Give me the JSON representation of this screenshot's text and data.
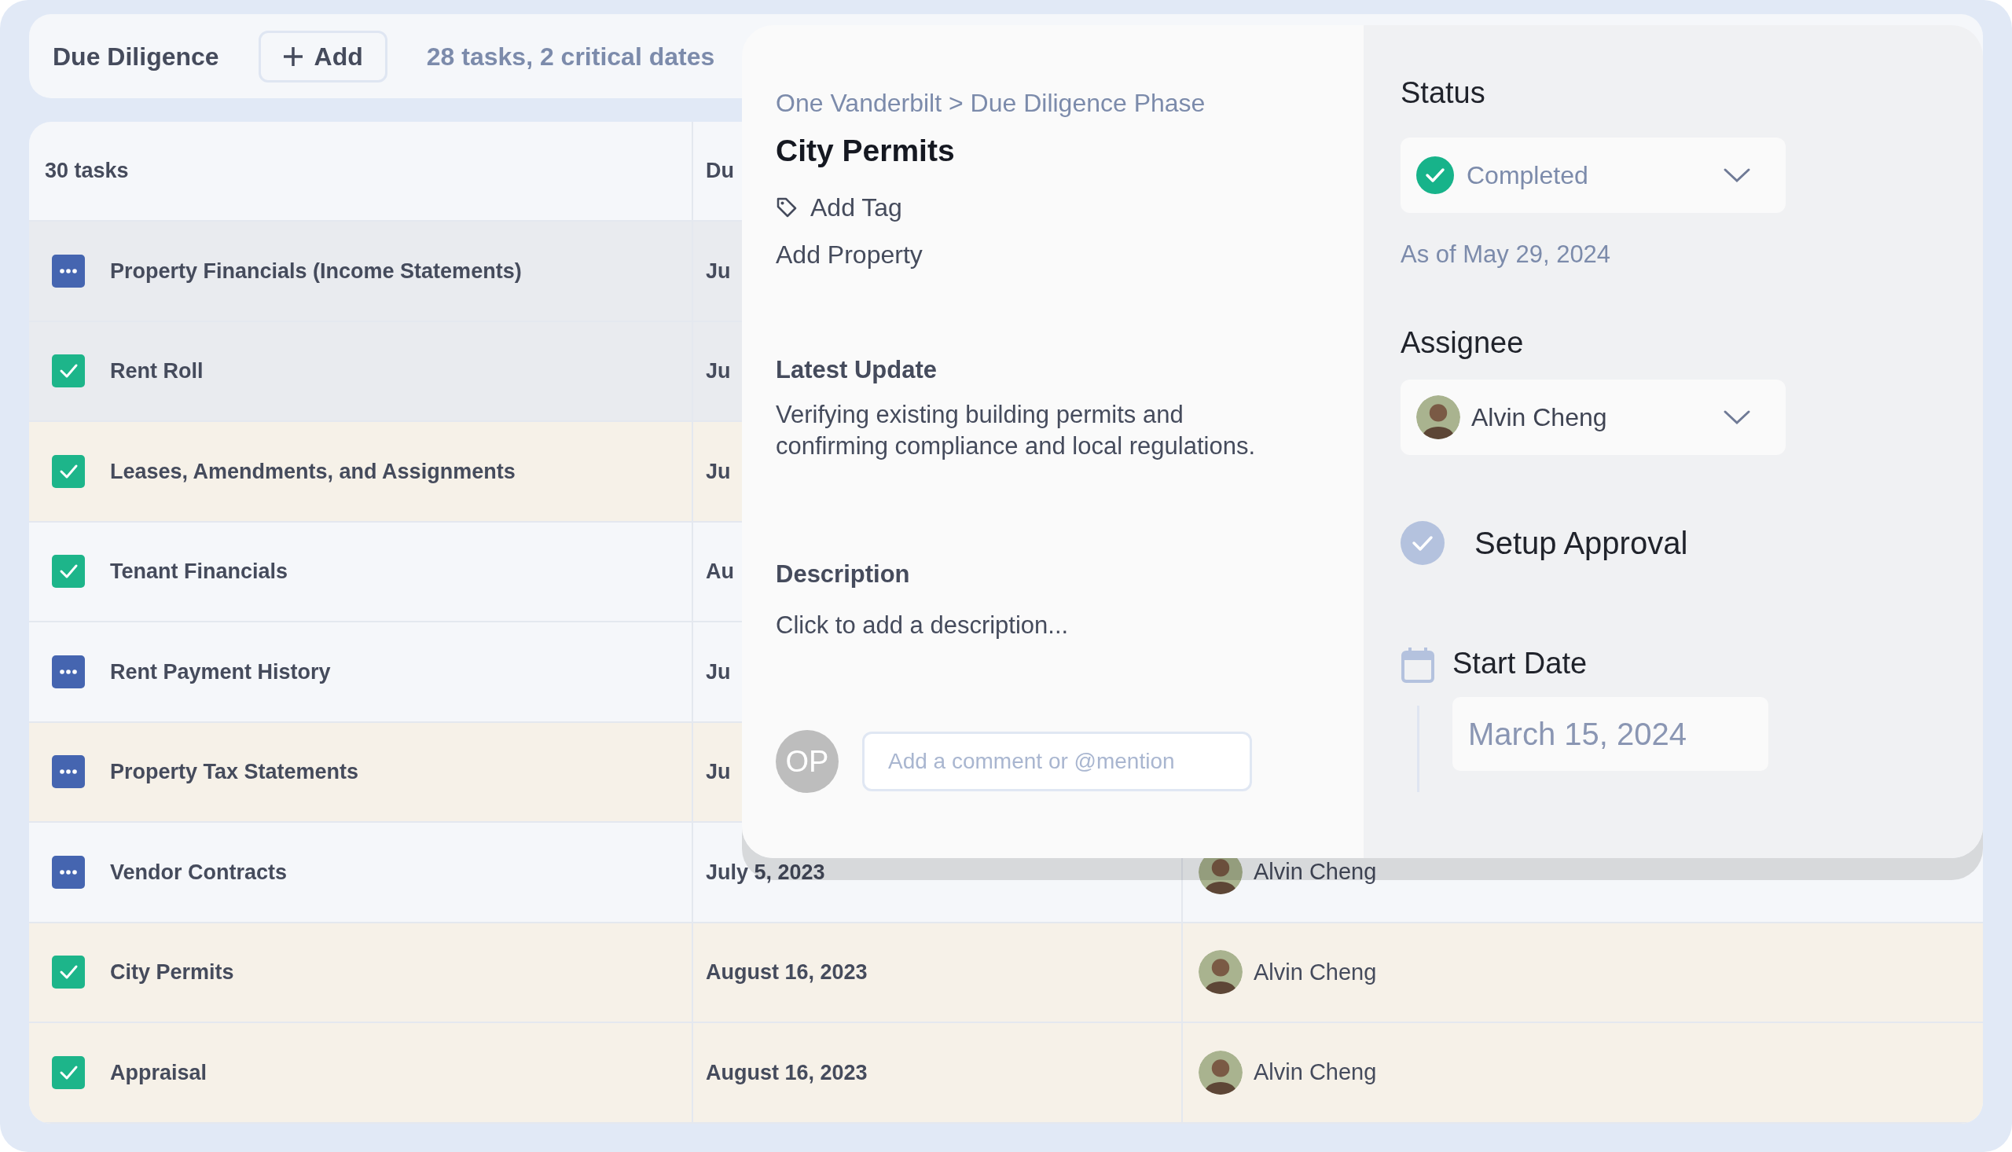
{
  "header": {
    "title": "Due Diligence",
    "add_button": "Add",
    "summary": "28 tasks, 2 critical dates"
  },
  "table": {
    "columns": [
      "30 tasks",
      "Du"
    ],
    "rows": [
      {
        "name": "Property Financials (Income Statements)",
        "done": false,
        "date": "Ju",
        "selected": true,
        "critical": false
      },
      {
        "name": "Rent Roll",
        "done": true,
        "date": "Ju",
        "selected": true,
        "critical": false
      },
      {
        "name": "Leases, Amendments, and Assignments",
        "done": true,
        "date": "Ju",
        "selected": false,
        "critical": true
      },
      {
        "name": "Tenant Financials",
        "done": true,
        "date": "Au",
        "selected": false,
        "critical": false
      },
      {
        "name": "Rent Payment History",
        "done": false,
        "date": "Ju",
        "selected": false,
        "critical": false
      },
      {
        "name": "Property Tax Statements",
        "done": false,
        "date": "Ju",
        "selected": false,
        "critical": true
      },
      {
        "name": "Vendor Contracts",
        "done": false,
        "date": "July 5, 2023",
        "assignee": "Alvin Cheng",
        "selected": false,
        "critical": false
      },
      {
        "name": "City Permits",
        "done": true,
        "date": "August 16, 2023",
        "assignee": "Alvin Cheng",
        "selected": false,
        "critical": true
      },
      {
        "name": "Appraisal",
        "done": true,
        "date": "August 16, 2023",
        "assignee": "Alvin Cheng",
        "selected": false,
        "critical": true
      }
    ]
  },
  "detail": {
    "breadcrumb": "One Vanderbilt > Due Diligence Phase",
    "title": "City Permits",
    "tag_button": "Add Tag",
    "property_button": "Add Property",
    "latest_update": {
      "label": "Latest Update",
      "text": "Verifying existing building permits and confirming compliance and local regulations."
    },
    "description": {
      "label": "Description",
      "text": "Click to add a description..."
    },
    "comment": {
      "avatar": "OP",
      "placeholder": "Add a comment or @mention"
    },
    "status": {
      "label": "Status",
      "value": "Completed",
      "completed": true,
      "as_of": "As of May 29, 2024"
    },
    "assignee": {
      "label": "Assignee",
      "name": "Alvin Cheng"
    },
    "approval": {
      "label": "Setup Approval",
      "checked": false
    },
    "start_date": {
      "label": "Start Date",
      "value": "March 15, 2024"
    }
  }
}
